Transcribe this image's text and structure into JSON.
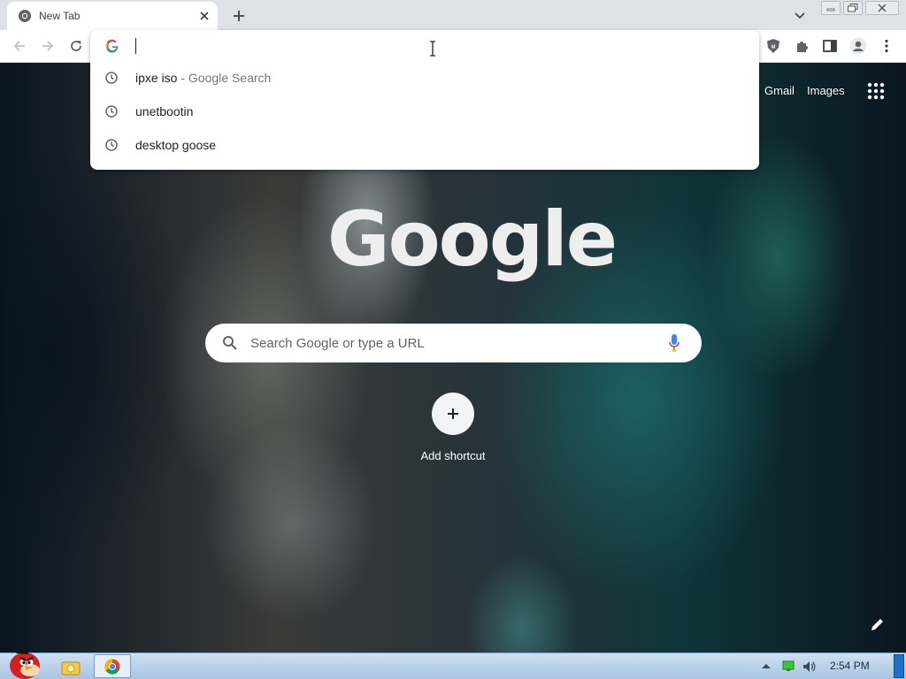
{
  "browser": {
    "tab": {
      "title": "New Tab",
      "favicon": "chrome-icon"
    },
    "omnibox": {
      "value": "",
      "suggestions": [
        {
          "icon": "history-icon",
          "text": "ipxe iso",
          "subtext": " - Google Search"
        },
        {
          "icon": "history-icon",
          "text": "unetbootin",
          "subtext": ""
        },
        {
          "icon": "history-icon",
          "text": "desktop goose",
          "subtext": ""
        }
      ]
    }
  },
  "ntp": {
    "top_links": {
      "gmail": "Gmail",
      "images": "Images"
    },
    "logo": "Google",
    "search": {
      "placeholder": "Search Google or type a URL"
    },
    "shortcut": {
      "label": "Add shortcut"
    }
  },
  "taskbar": {
    "clock": "2:54 PM"
  },
  "colors": {
    "google_blue": "#4285f4",
    "google_red": "#ea4335",
    "google_yellow": "#fbbc05",
    "google_green": "#34a853",
    "taskbar": "#b6cde8",
    "show_desktop": "#1f6fc4"
  }
}
